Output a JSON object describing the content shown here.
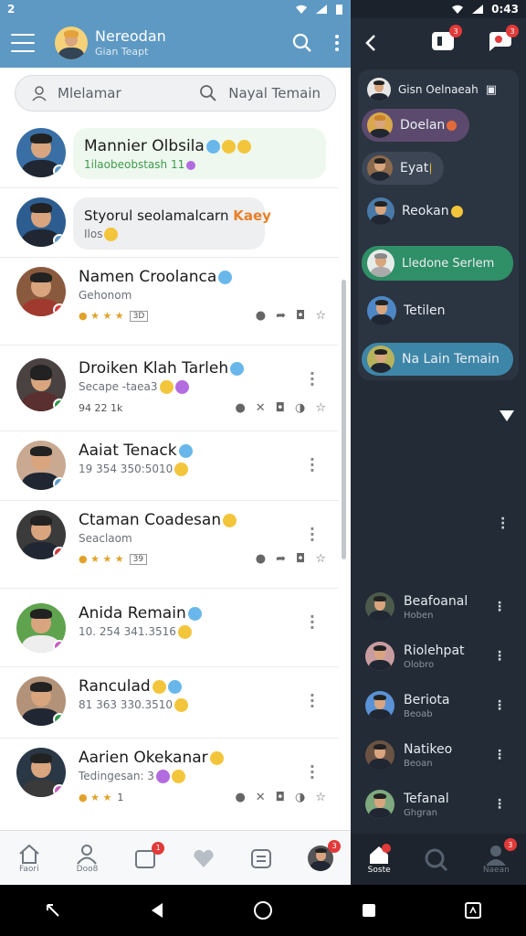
{
  "status_bar": {
    "left_time": "2",
    "right_time": "0:43"
  },
  "header": {
    "title": "Nereodan",
    "subtitle": "Gian Teapt"
  },
  "search": {
    "left_text": "Mlelamar",
    "right_text": "Nayal Temain"
  },
  "chats": [
    {
      "name": "Mannier Olbsila",
      "sub": "1ilaobeobstash 11",
      "style": "bubble-green",
      "avatar": "#3a6fa5",
      "badge": "#5d9bcc"
    },
    {
      "name": "Styorul seolamalcarn",
      "tag": "Kaey",
      "sub": "Ilos",
      "style": "bubble-grey",
      "avatar": "#2d5d90",
      "badge": "#5d9bcc"
    },
    {
      "name": "Namen Croolanca",
      "sub": "Gehonom",
      "stats": "3D",
      "avatar": "#8a5a3e",
      "badge": "#d23b3b"
    },
    {
      "name": "Droiken Klah Tarleh",
      "sub": "Secape -taea3",
      "extra": "94 22 1k",
      "avatar": "#4a4240",
      "badge": "#2f9a4a"
    },
    {
      "name": "Aaiat Tenack",
      "sub": "19 354 350:5010",
      "avatar": "#7a5c48",
      "badge": "#5d9bcc"
    },
    {
      "name": "Ctaman Coadesan",
      "sub": "Seaclaom",
      "stats": "39",
      "avatar": "#3b3b3b",
      "badge": "#d23b3b"
    },
    {
      "name": "Anida Remain",
      "sub": "10. 254 341.3516",
      "avatar": "#3f7d3a",
      "badge": "#c75fc1"
    },
    {
      "name": "Ranculad",
      "sub": "81 363 330.3510",
      "avatar": "#5f4a3c",
      "badge": "#2f9a4a"
    },
    {
      "name": "Aarien Okekanar",
      "sub": "Tedingesan: 3",
      "stats": "1",
      "avatar": "#2a3846",
      "badge": "#c75fc1"
    }
  ],
  "left_nav": [
    {
      "icon": "home-icon",
      "label": "Faori"
    },
    {
      "icon": "profile-icon",
      "label": "Doo8"
    },
    {
      "icon": "calendar-icon",
      "label": "",
      "badge": "1"
    },
    {
      "icon": "heart-icon",
      "label": ""
    },
    {
      "icon": "list-icon",
      "label": ""
    },
    {
      "icon": "avatar-icon",
      "label": "",
      "badge": "3"
    }
  ],
  "right_panel": {
    "header_badges": [
      "3",
      "3"
    ],
    "chips": [
      {
        "label": "Gisn Oelnaeah"
      },
      {
        "label": "Doelan"
      },
      {
        "label": "Eyat"
      },
      {
        "label": "Reokan"
      },
      {
        "label": "Lledone Serlem"
      },
      {
        "label": "Tetilen"
      },
      {
        "label": "Na Lain Temain"
      }
    ],
    "rows": [
      {
        "name": "Beafoanal",
        "sub": "Hoben"
      },
      {
        "name": "Riolehpat",
        "sub": "Olobro"
      },
      {
        "name": "Beriota",
        "sub": "Beoab"
      },
      {
        "name": "Natikeo",
        "sub": "Beoan"
      },
      {
        "name": "Tefanal",
        "sub": "Ghgran"
      }
    ],
    "nav": [
      {
        "label": "Soste"
      },
      {
        "label": ""
      },
      {
        "label": "Naean",
        "badge": "3"
      }
    ]
  }
}
